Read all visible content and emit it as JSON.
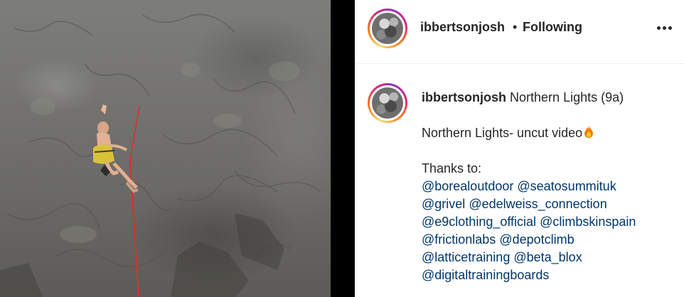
{
  "media": {
    "description_icon": "video-frame"
  },
  "header": {
    "username": "ibbertsonjosh",
    "separator": "•",
    "follow_status": "Following",
    "more_icon": "more-horizontal-icon"
  },
  "caption": {
    "username": "ibbertsonjosh",
    "title": "Northern Lights (9a)",
    "line1": "Northern Lights- uncut video",
    "emoji": "fire-icon",
    "thanks": "Thanks to:",
    "mention_lines": [
      [
        "@borealoutdoor",
        "@seatosummituk"
      ],
      [
        "@grivel",
        "@edelweiss_connection"
      ],
      [
        "@e9clothing_official",
        "@climbskinspain"
      ],
      [
        "@frictionlabs",
        "@depotclimb"
      ],
      [
        "@latticetraining",
        "@beta_blox"
      ],
      [
        "@digitaltrainingboards"
      ]
    ]
  },
  "colors": {
    "text": "#262626",
    "mention": "#00376b",
    "ring_start": "#feda75",
    "ring_end": "#962fbf"
  }
}
